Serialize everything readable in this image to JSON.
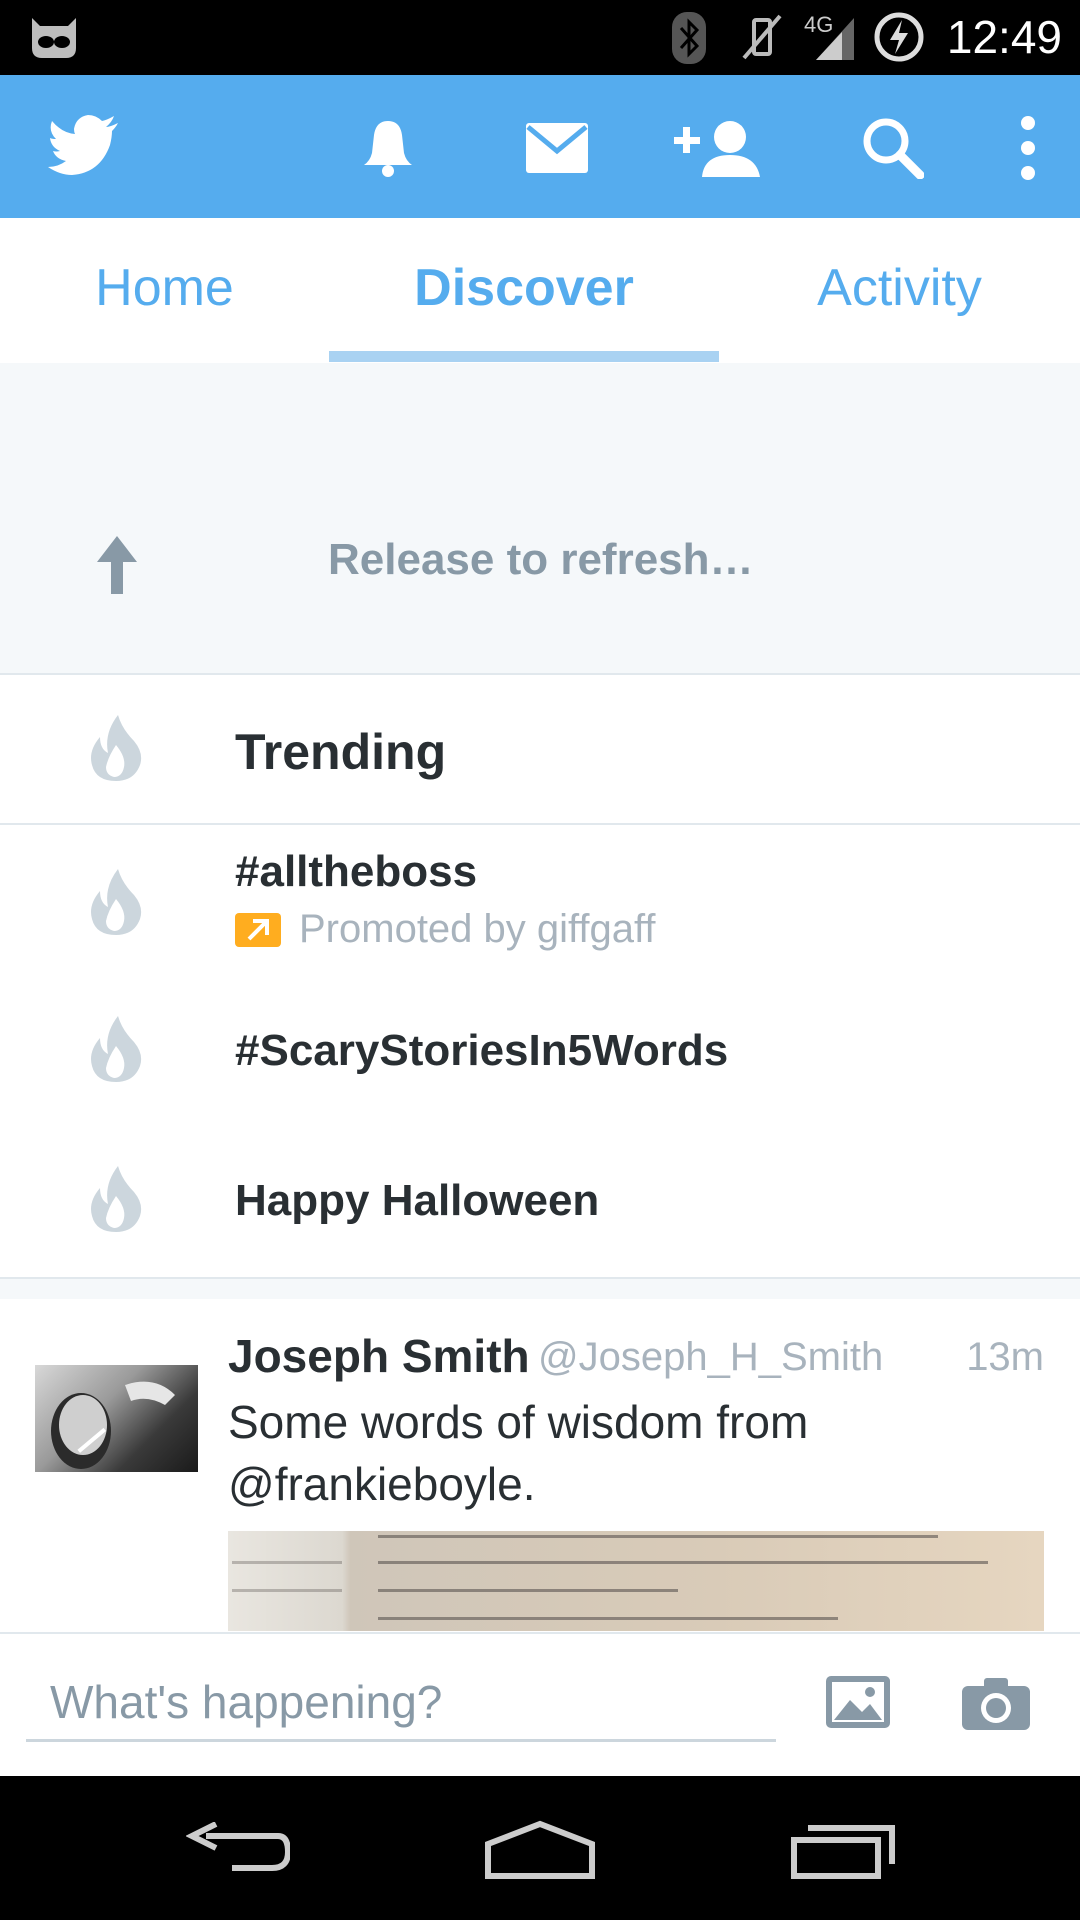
{
  "status_bar": {
    "time": "12:49",
    "network": "4G",
    "icons": [
      "cyanogen-mascot-icon",
      "bluetooth-icon",
      "vibrate-off-icon",
      "signal-icon",
      "battery-charging-icon"
    ]
  },
  "action_bar": {
    "icons": [
      "twitter-bird-icon",
      "notifications-bell-icon",
      "messages-envelope-icon",
      "add-user-icon",
      "search-icon",
      "overflow-menu-icon"
    ],
    "accent_color": "#55acee"
  },
  "tabs": [
    {
      "label": "Home",
      "active": false
    },
    {
      "label": "Discover",
      "active": true
    },
    {
      "label": "Activity",
      "active": false
    }
  ],
  "refresh": {
    "text": "Release to refresh…",
    "icon": "arrow-up-icon"
  },
  "trends": {
    "title": "Trending",
    "items": [
      {
        "name": "#alltheboss",
        "promoted_text": "Promoted by giffgaff"
      },
      {
        "name": "#ScaryStoriesIn5Words"
      },
      {
        "name": "Happy Halloween"
      }
    ],
    "icon": "flame-icon"
  },
  "tweet": {
    "name": "Joseph Smith",
    "handle": "@Joseph_H_Smith",
    "time": "13m",
    "text": "Some words of wisdom from @frankieboyle."
  },
  "compose": {
    "placeholder": "What's happening?",
    "icons": [
      "image-icon",
      "camera-icon"
    ]
  },
  "nav_bar": {
    "icons": [
      "back-icon",
      "home-icon",
      "recents-icon"
    ]
  }
}
